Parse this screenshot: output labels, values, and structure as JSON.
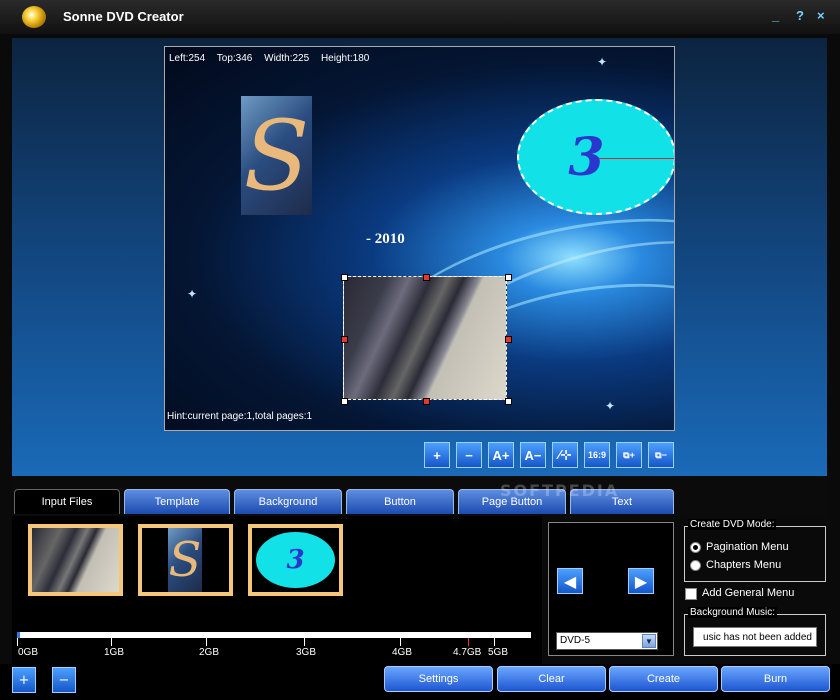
{
  "window": {
    "title": "Sonne DVD Creator",
    "controls": {
      "minimize": "_",
      "help": "?",
      "close": "×"
    }
  },
  "canvas": {
    "coords": {
      "left": "Left:254",
      "top": "Top:346",
      "width": "Width:225",
      "height": "Height:180"
    },
    "year_text": "- 2010",
    "clock_digit": "3",
    "logo_letter": "S",
    "hint": "Hint:current page:1,total pages:1"
  },
  "toolbar": {
    "buttons": [
      {
        "name": "zoom-in",
        "label": "+"
      },
      {
        "name": "zoom-out",
        "label": "−"
      },
      {
        "name": "font-larger",
        "label": "A+"
      },
      {
        "name": "font-smaller",
        "label": "A−"
      },
      {
        "name": "text-path",
        "label": "∕⊹"
      },
      {
        "name": "aspect-ratio",
        "label": "16:9"
      },
      {
        "name": "add-item",
        "label": "⧉+"
      },
      {
        "name": "remove-item",
        "label": "⧉−"
      }
    ]
  },
  "tabs": [
    {
      "label": "Input Files",
      "active": true
    },
    {
      "label": "Template",
      "active": false
    },
    {
      "label": "Background",
      "active": false
    },
    {
      "label": "Button",
      "active": false
    },
    {
      "label": "Page Button",
      "active": false
    },
    {
      "label": "Text",
      "active": false
    }
  ],
  "watermark": "SOFTPEDIA",
  "timeline": {
    "ticks": [
      "0GB",
      "1GB",
      "2GB",
      "3GB",
      "4GB",
      "4.7GB",
      "5GB"
    ]
  },
  "navigation": {
    "prev": "◀",
    "next": "▶",
    "dvd_type": "DVD-5",
    "dropdown_icon": "▼"
  },
  "dvd_mode": {
    "legend": "Create DVD Mode:",
    "options": [
      {
        "label": "Pagination Menu",
        "selected": true
      },
      {
        "label": "Chapters Menu",
        "selected": false
      }
    ]
  },
  "general_menu": {
    "label": "Add General Menu",
    "checked": false
  },
  "background_music": {
    "legend": "Background Music:",
    "value": "usic has not been added"
  },
  "bottom": {
    "add_file_icon": "+",
    "remove_file_icon": "−",
    "settings": "Settings",
    "clear": "Clear",
    "create": "Create",
    "burn": "Burn"
  }
}
